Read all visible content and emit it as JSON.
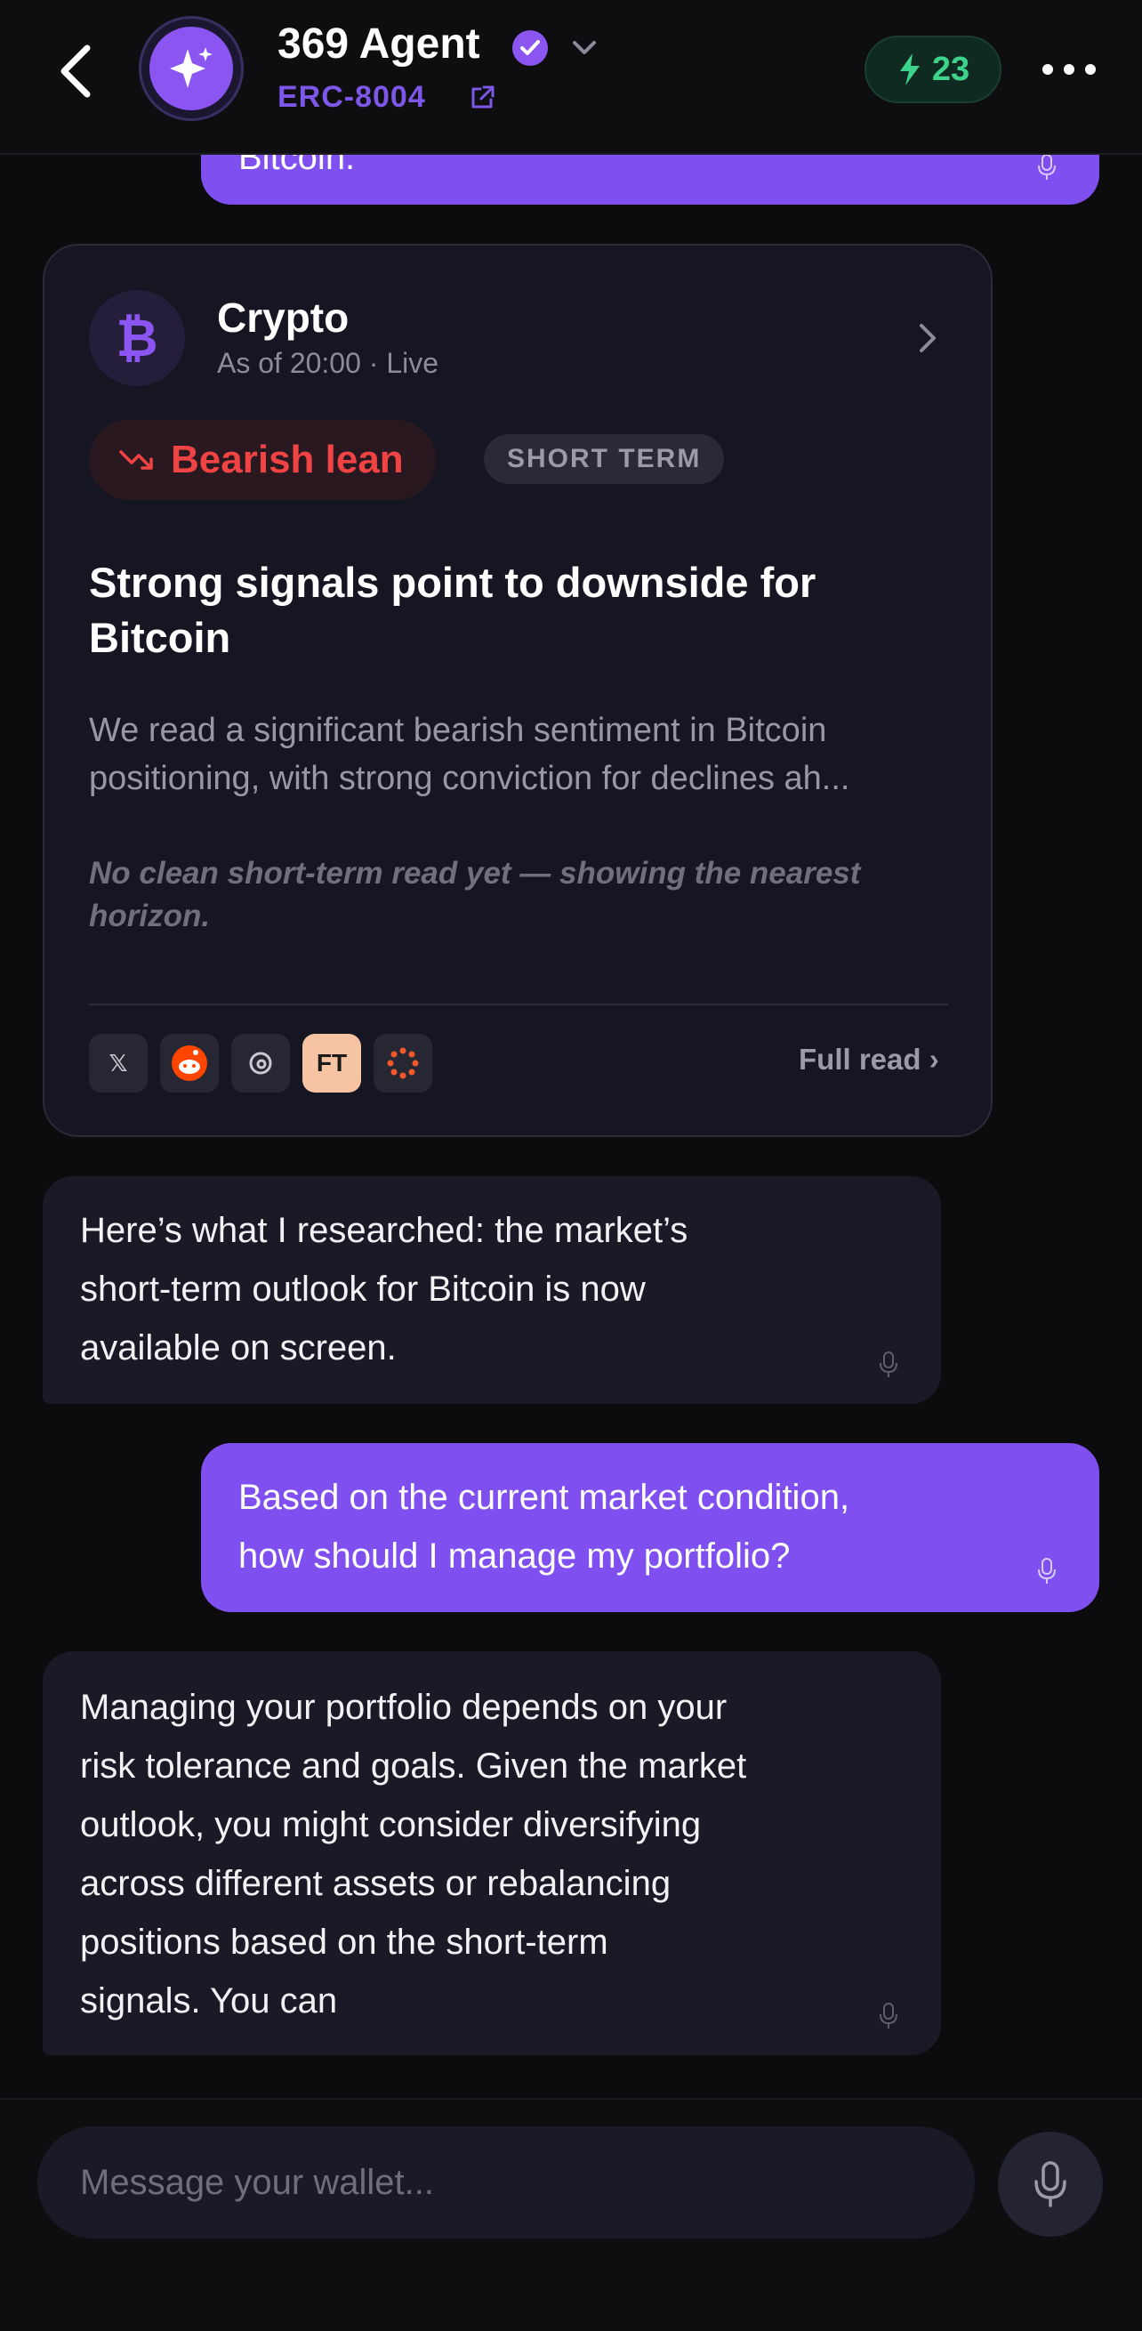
{
  "header": {
    "agent_name": "369 Agent",
    "agent_standard": "ERC-8004",
    "energy_count": "23"
  },
  "messages": {
    "top_user_partial": "Bitcoin.",
    "agent_1": [
      "Here’s what I researched: the market’s",
      "short-term outlook for Bitcoin is now",
      "available on screen."
    ],
    "user_2": [
      "Based on the current market condition,",
      "how should I manage my portfolio?"
    ],
    "agent_3": [
      "Managing your portfolio depends on your",
      "risk tolerance and goals. Given the market",
      "outlook, you might consider diversifying",
      "across different assets or rebalancing",
      "positions based on the short-term",
      "signals. You can"
    ]
  },
  "card": {
    "coin_symbol": "₿",
    "title": "Crypto",
    "subtitle": "As of 20:00 · Live",
    "sentiment_label": "Bearish lean",
    "term_label": "SHORT TERM",
    "headline": "Strong signals point to downside for Bitcoin",
    "body_line1": "We read a significant bearish sentiment in Bitcoin",
    "body_line2": "positioning, with strong conviction for declines ah...",
    "note": "No clean short-term read yet — showing the nearest horizon.",
    "sources": [
      "𝕏",
      "reddit",
      "threads",
      "FT",
      "dots"
    ],
    "ft_label": "FT",
    "x_label": "𝕏",
    "full_read_label": "Full read ›"
  },
  "input": {
    "placeholder": "Message your wallet..."
  },
  "colors": {
    "accent": "#7f4ff0",
    "bearish": "#f04444",
    "energy": "#3ed38a"
  }
}
